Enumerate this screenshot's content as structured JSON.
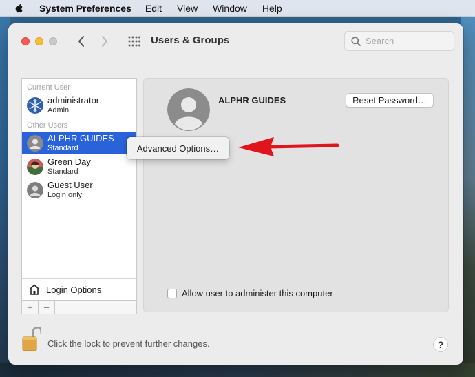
{
  "menubar": {
    "app": "System Preferences",
    "items": [
      "Edit",
      "View",
      "Window",
      "Help"
    ]
  },
  "window": {
    "title": "Users & Groups",
    "search_placeholder": "Search"
  },
  "sidebar": {
    "current_user_label": "Current User",
    "other_users_label": "Other Users",
    "users": [
      {
        "name": "administrator",
        "role": "Admin"
      },
      {
        "name": "ALPHR GUIDES",
        "role": "Standard",
        "selected": true
      },
      {
        "name": "Green Day",
        "role": "Standard"
      },
      {
        "name": "Guest User",
        "role": "Login only"
      }
    ],
    "login_options": "Login Options",
    "add": "+",
    "remove": "−"
  },
  "panel": {
    "user_title": "ALPHR GUIDES",
    "reset_password": "Reset Password…",
    "allow_admin": "Allow user to administer this computer"
  },
  "popup": {
    "advanced_options": "Advanced Options…"
  },
  "footer": {
    "lock_text": "Click the lock to prevent further changes.",
    "help": "?"
  },
  "colors": {
    "selection": "#2962d9",
    "annotation_arrow": "#e0141c"
  }
}
